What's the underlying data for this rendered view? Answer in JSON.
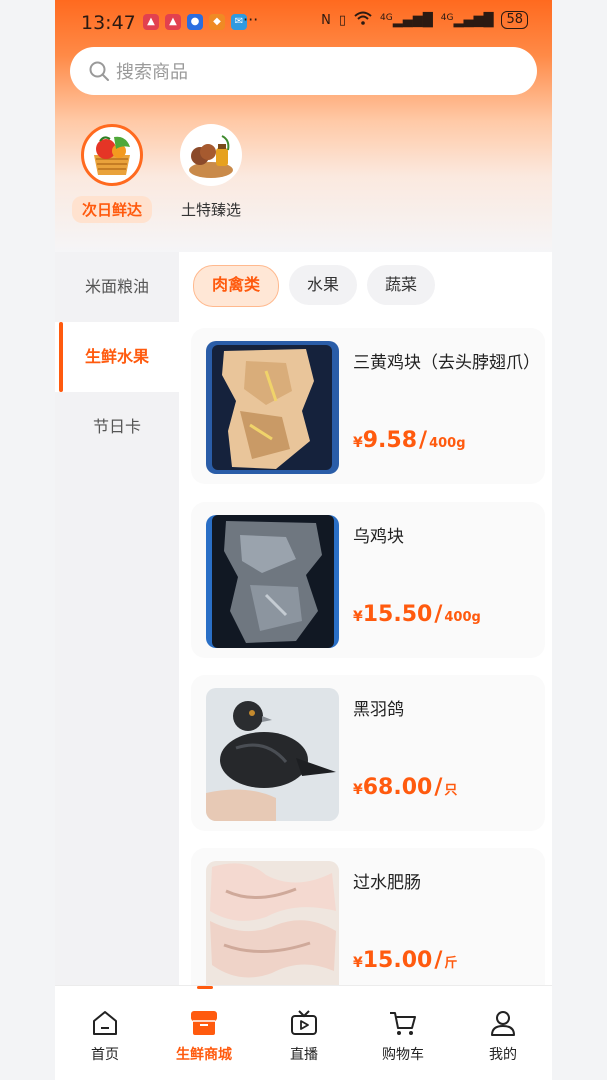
{
  "status": {
    "time": "13:47",
    "signal_4g_1": "4G",
    "signal_4g_2": "4G",
    "battery": "58"
  },
  "search": {
    "placeholder": "搜索商品"
  },
  "top_categories": [
    {
      "label": "次日鲜达",
      "active": true
    },
    {
      "label": "土特臻选",
      "active": false
    }
  ],
  "sidebar": {
    "items": [
      {
        "label": "米面粮油"
      },
      {
        "label": "生鲜水果"
      },
      {
        "label": "节日卡"
      }
    ],
    "active_index": 1
  },
  "chips": [
    {
      "label": "肉禽类"
    },
    {
      "label": "水果"
    },
    {
      "label": "蔬菜"
    }
  ],
  "products": [
    {
      "name": "三黄鸡块（去头脖翅爪）",
      "currency": "¥",
      "price": "9.58",
      "slash": "/",
      "unit": "400g"
    },
    {
      "name": "乌鸡块",
      "currency": "¥",
      "price": "15.50",
      "slash": "/",
      "unit": "400g"
    },
    {
      "name": "黑羽鸽",
      "currency": "¥",
      "price": "68.00",
      "slash": "/",
      "unit": "只"
    },
    {
      "name": "过水肥肠",
      "currency": "¥",
      "price": "15.00",
      "slash": "/",
      "unit": "斤"
    }
  ],
  "tabbar": [
    {
      "label": "首页",
      "icon": "home-icon"
    },
    {
      "label": "生鲜商城",
      "icon": "store-icon"
    },
    {
      "label": "直播",
      "icon": "live-tv-icon"
    },
    {
      "label": "购物车",
      "icon": "cart-icon"
    },
    {
      "label": "我的",
      "icon": "profile-icon"
    }
  ],
  "colors": {
    "accent": "#ff5a0e",
    "header_gradient_top": "#ff6a1f"
  }
}
